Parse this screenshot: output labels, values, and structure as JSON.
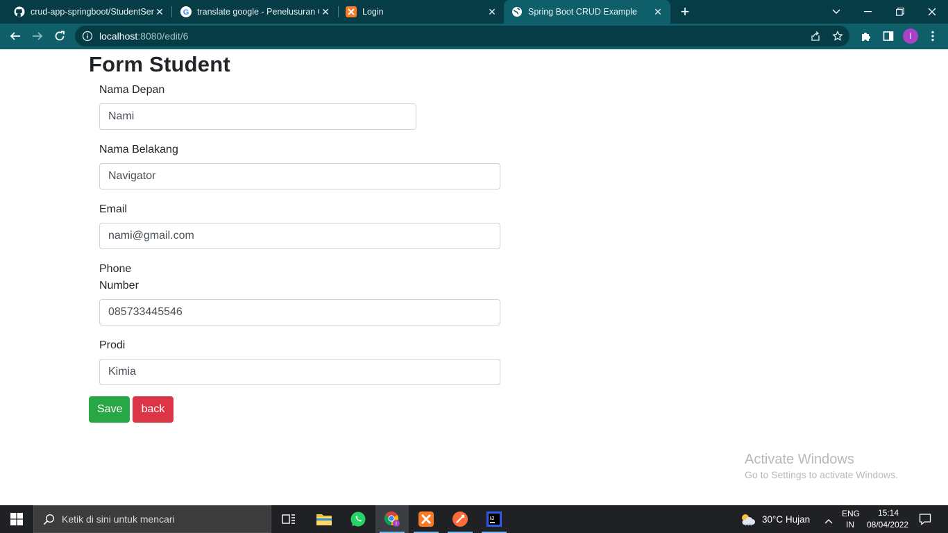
{
  "browser": {
    "tabs": [
      {
        "title": "crud-app-springboot/StudentSer",
        "favicon": "github-icon",
        "active": false
      },
      {
        "title": "translate google - Penelusuran G",
        "favicon": "google-icon",
        "active": false
      },
      {
        "title": "Login",
        "favicon": "xampp-icon",
        "active": false
      },
      {
        "title": "Spring Boot CRUD Example",
        "favicon": "globe-icon",
        "active": true
      }
    ],
    "url_host": "localhost",
    "url_path": ":8080/edit/6",
    "profile_initial": "I",
    "colors": {
      "tabbar": "#053c45",
      "toolbar": "#0e5f69",
      "profile": "#a742c9"
    }
  },
  "page": {
    "title": "Form Student",
    "fields": [
      {
        "label": "Nama Depan",
        "value": "Nami"
      },
      {
        "label": "Nama Belakang",
        "value": "Navigator"
      },
      {
        "label": "Email",
        "value": "nami@gmail.com"
      },
      {
        "label_line1": "Phone",
        "label_line2": "Number",
        "value": "085733445546"
      },
      {
        "label": "Prodi",
        "value": "Kimia"
      }
    ],
    "save_label": "Save",
    "back_label": "back",
    "colors": {
      "save": "#28a745",
      "back": "#dc3545"
    }
  },
  "watermark": {
    "line1": "Activate Windows",
    "line2": "Go to Settings to activate Windows."
  },
  "taskbar": {
    "search_placeholder": "Ketik di sini untuk mencari",
    "weather": "30°C  Hujan",
    "lang_line1": "ENG",
    "lang_line2": "IN",
    "time": "15:14",
    "date": "08/04/2022"
  }
}
